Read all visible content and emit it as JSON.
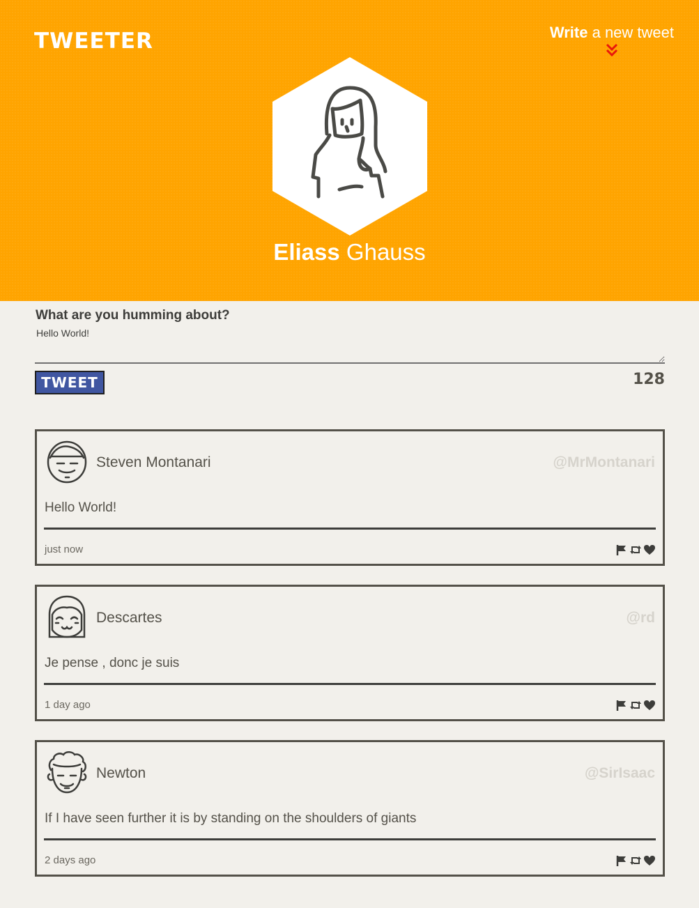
{
  "header": {
    "logo": "TWEETER",
    "compose_link_bold": "Write",
    "compose_link_rest": " a new tweet",
    "profile_first_name": "Eliass",
    "profile_last_name": " Ghauss"
  },
  "compose": {
    "label": "What are you humming about?",
    "value": "Hello World!",
    "button_label": "TWEET",
    "char_counter": "128"
  },
  "tweets": [
    {
      "name": "Steven Montanari",
      "handle": "@MrMontanari",
      "text": "Hello World!",
      "time": "just now",
      "avatar_icon": "man-avatar-icon"
    },
    {
      "name": "Descartes",
      "handle": "@rd",
      "text": "Je pense , donc je suis",
      "time": "1 day ago",
      "avatar_icon": "woman-bangs-avatar-icon"
    },
    {
      "name": "Newton",
      "handle": "@SirIsaac",
      "text": "If I have seen further it is by standing on the shoulders of giants",
      "time": "2 days ago",
      "avatar_icon": "curly-hair-avatar-icon"
    }
  ],
  "colors": {
    "header_bg": "#ffa400",
    "page_bg": "#f2f0eb",
    "tweet_button_bg": "#4056a1",
    "chevron": "#e8170c",
    "handle": "#d6d3cc",
    "ink": "#545149"
  },
  "icons": {
    "chevron": "double-chevron-down-icon",
    "flag": "flag-icon",
    "retweet": "retweet-icon",
    "like": "heart-icon"
  }
}
